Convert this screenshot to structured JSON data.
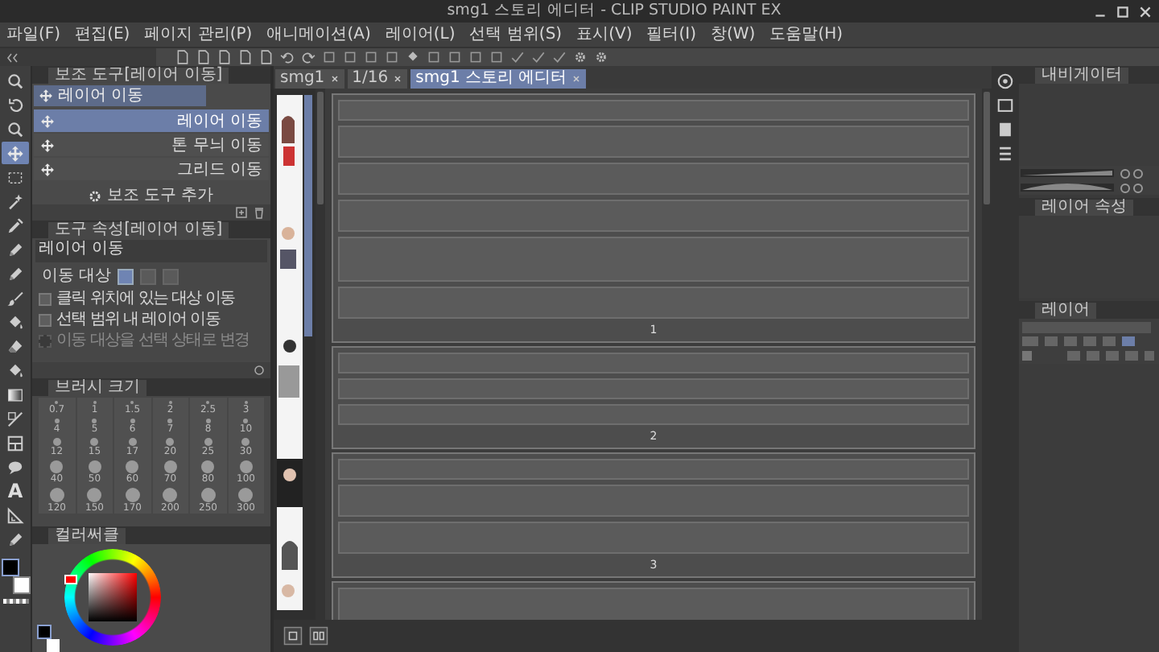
{
  "window": {
    "title": "smg1 스토리 에디터 - CLIP STUDIO PAINT EX"
  },
  "menu": [
    "파일(F)",
    "편집(E)",
    "페이지 관리(P)",
    "애니메이션(A)",
    "레이어(L)",
    "선택 범위(S)",
    "표시(V)",
    "필터(I)",
    "창(W)",
    "도움말(H)"
  ],
  "toolbar": [
    {
      "kind": "doc"
    },
    {
      "kind": "doc"
    },
    {
      "kind": "doc"
    },
    {
      "kind": "doc"
    },
    {
      "kind": "doc"
    },
    {
      "kind": "undo"
    },
    {
      "kind": "redo"
    },
    {
      "kind": "square"
    },
    {
      "kind": "square"
    },
    {
      "kind": "square"
    },
    {
      "kind": "square"
    },
    {
      "kind": "fill"
    },
    {
      "kind": "square"
    },
    {
      "kind": "square"
    },
    {
      "kind": "square"
    },
    {
      "kind": "square"
    },
    {
      "kind": "check"
    },
    {
      "kind": "check"
    },
    {
      "kind": "check"
    },
    {
      "kind": "gear"
    },
    {
      "kind": "gear"
    }
  ],
  "tools": [
    {
      "kind": "zoom",
      "selected": false
    },
    {
      "kind": "rotate",
      "selected": false
    },
    {
      "kind": "zoom",
      "selected": false
    },
    {
      "kind": "move",
      "selected": true
    },
    {
      "kind": "select",
      "selected": false
    },
    {
      "kind": "wand",
      "selected": false
    },
    {
      "kind": "dropper",
      "selected": false
    },
    {
      "kind": "pen",
      "selected": false
    },
    {
      "kind": "pen",
      "selected": false
    },
    {
      "kind": "brush",
      "selected": false
    },
    {
      "kind": "fill",
      "selected": false
    },
    {
      "kind": "eraser",
      "selected": false
    },
    {
      "kind": "fill",
      "selected": false
    },
    {
      "kind": "gradient",
      "selected": false
    },
    {
      "kind": "figure",
      "selected": false
    },
    {
      "kind": "frame",
      "selected": false
    },
    {
      "kind": "balloon",
      "selected": false
    },
    {
      "kind": "text",
      "glyph": "A",
      "selected": false
    },
    {
      "kind": "ruler",
      "selected": false
    },
    {
      "kind": "pen",
      "selected": false
    }
  ],
  "tool_colors": [
    {
      "kind": "main",
      "color": "#000000"
    },
    {
      "kind": "sub",
      "color": "#ffffff"
    }
  ],
  "subtool": {
    "title": "보조 도구[레이어 이동]",
    "group": "레이어 이동",
    "items": [
      {
        "label": "레이어 이동",
        "selected": true
      },
      {
        "label": "톤 무늬 이동",
        "selected": false
      },
      {
        "label": "그리드 이동",
        "selected": false
      }
    ],
    "add_button": "보조 도구 추가"
  },
  "tool_property": {
    "title": "도구 속성[레이어 이동]",
    "name": "레이어 이동",
    "target_label": "이동 대상",
    "targets": [
      {
        "selected": true
      },
      {
        "selected": false
      },
      {
        "selected": false
      }
    ],
    "options": [
      {
        "label": "클릭 위치에 있는 대상 이동",
        "checked": false,
        "disabled": false
      },
      {
        "label": "선택 범위 내 레이어 이동",
        "checked": false,
        "disabled": false
      },
      {
        "label": "이동 대상을 선택 상태로 변경",
        "checked": false,
        "disabled": true
      }
    ]
  },
  "brush_size": {
    "title": "브러시 크기",
    "sizes": [
      [
        "0.7",
        "1",
        "1.5",
        "2",
        "2.5",
        "3"
      ],
      [
        "4",
        "5",
        "6",
        "7",
        "8",
        "10"
      ],
      [
        "12",
        "15",
        "17",
        "20",
        "25",
        "30"
      ],
      [
        "40",
        "50",
        "60",
        "70",
        "80",
        "100"
      ],
      [
        "120",
        "150",
        "170",
        "200",
        "250",
        "300"
      ]
    ]
  },
  "color_panel": {
    "title": "컬러써클",
    "hue": {
      "color": "#ff0000"
    },
    "swatches": [
      {
        "kind": "main",
        "color": "#000000"
      },
      {
        "kind": "sub",
        "color": "#ffffff"
      }
    ]
  },
  "document_tabs": [
    {
      "label": "smg1",
      "selected": false
    },
    {
      "label": "1/16",
      "selected": false
    },
    {
      "label": "smg1 스토리 에디터",
      "selected": true
    }
  ],
  "story": {
    "pages": [
      {
        "number": "1",
        "frames": [
          {
            "kind": "short"
          },
          {
            "kind": "mid"
          },
          {
            "kind": "mid"
          },
          {
            "kind": "mid"
          },
          {
            "kind": "tall"
          },
          {
            "kind": "mid"
          }
        ]
      },
      {
        "number": "2",
        "frames": [
          {
            "kind": "short"
          },
          {
            "kind": "short"
          },
          {
            "kind": "short"
          }
        ]
      },
      {
        "number": "3",
        "frames": [
          {
            "kind": "short"
          },
          {
            "kind": "mid"
          },
          {
            "kind": "mid"
          }
        ]
      },
      {
        "frames": [
          {
            "kind": "tall"
          }
        ]
      }
    ]
  },
  "right_panels": [
    {
      "title": "내비게이터",
      "kind": "navigator"
    },
    {
      "title": "레이어 속성",
      "kind": "property"
    },
    {
      "title": "레이어",
      "kind": "layers"
    }
  ]
}
